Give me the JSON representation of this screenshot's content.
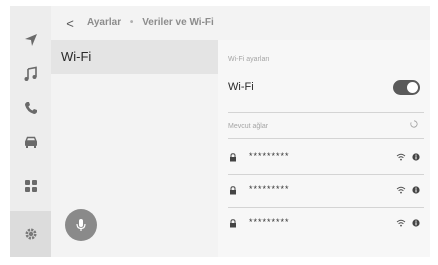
{
  "breadcrumb": {
    "back_icon": "chevron-left-icon",
    "parent": "Ayarlar",
    "separator": "•",
    "current": "Veriler ve Wi-Fi"
  },
  "rail": {
    "items": [
      {
        "icon": "navigation-icon"
      },
      {
        "icon": "music-icon"
      },
      {
        "icon": "phone-icon"
      },
      {
        "icon": "car-icon"
      },
      {
        "icon": "apps-grid-icon"
      },
      {
        "icon": "settings-gear-icon",
        "active": true
      }
    ]
  },
  "menu": {
    "items": [
      {
        "label": "Wi-Fi",
        "selected": true
      }
    ],
    "mic_icon": "microphone-icon"
  },
  "settings": {
    "section_title": "Wi-Fi ayarları",
    "wifi_label": "Wi-Fi",
    "wifi_enabled": true,
    "networks_title": "Mevcut ağlar",
    "networks": [
      {
        "ssid": "*********",
        "locked": true
      },
      {
        "ssid": "*********",
        "locked": true
      },
      {
        "ssid": "*********",
        "locked": true
      }
    ]
  },
  "colors": {
    "background": "#f3f3f3",
    "toggle_on": "#5a5a5a",
    "selected_row": "#e4e4e4",
    "mic_button": "#8a8a8a"
  }
}
